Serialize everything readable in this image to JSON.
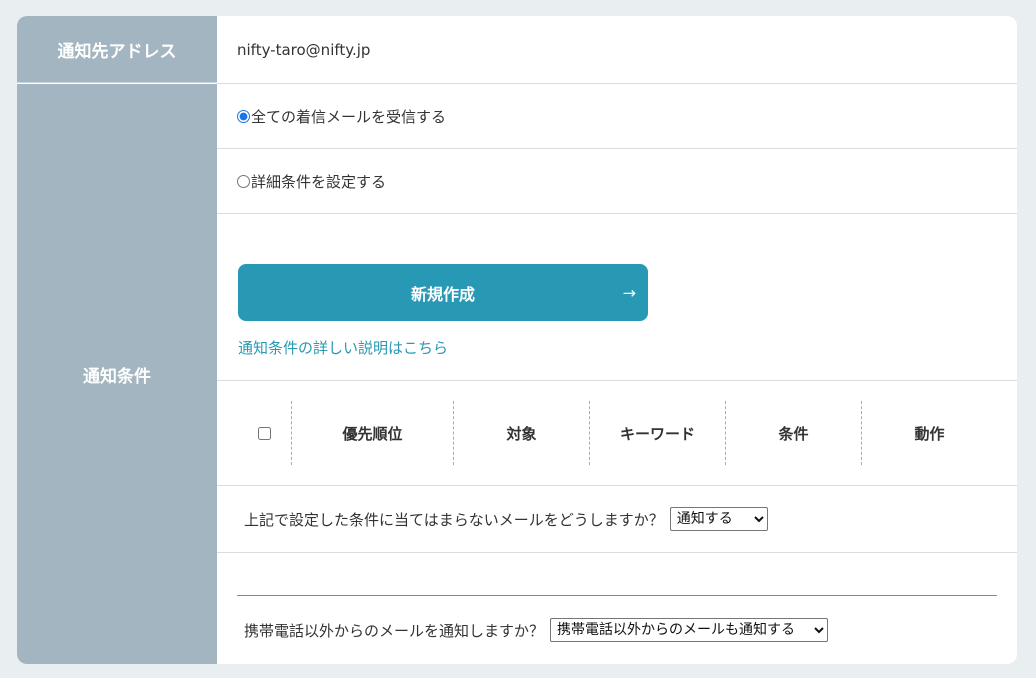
{
  "labels": {
    "address": "通知先アドレス",
    "conditions": "通知条件"
  },
  "address": {
    "email": "nifty-taro@nifty.jp"
  },
  "receive_options": [
    {
      "label": "全ての着信メールを受信する",
      "selected": true
    },
    {
      "label": "詳細条件を設定する",
      "selected": false
    }
  ],
  "create": {
    "button_label": "新規作成",
    "arrow": "→",
    "help_link": "通知条件の詳しい説明はこちら"
  },
  "table": {
    "headers": [
      "優先順位",
      "対象",
      "キーワード",
      "条件",
      "動作"
    ]
  },
  "unmatched": {
    "question": "上記で設定した条件に当てはまらないメールをどうしますか？",
    "selected": "通知する"
  },
  "mobile": {
    "question": "携帯電話以外からのメールを通知しますか？",
    "selected": "携帯電話以外からのメールも通知する"
  }
}
